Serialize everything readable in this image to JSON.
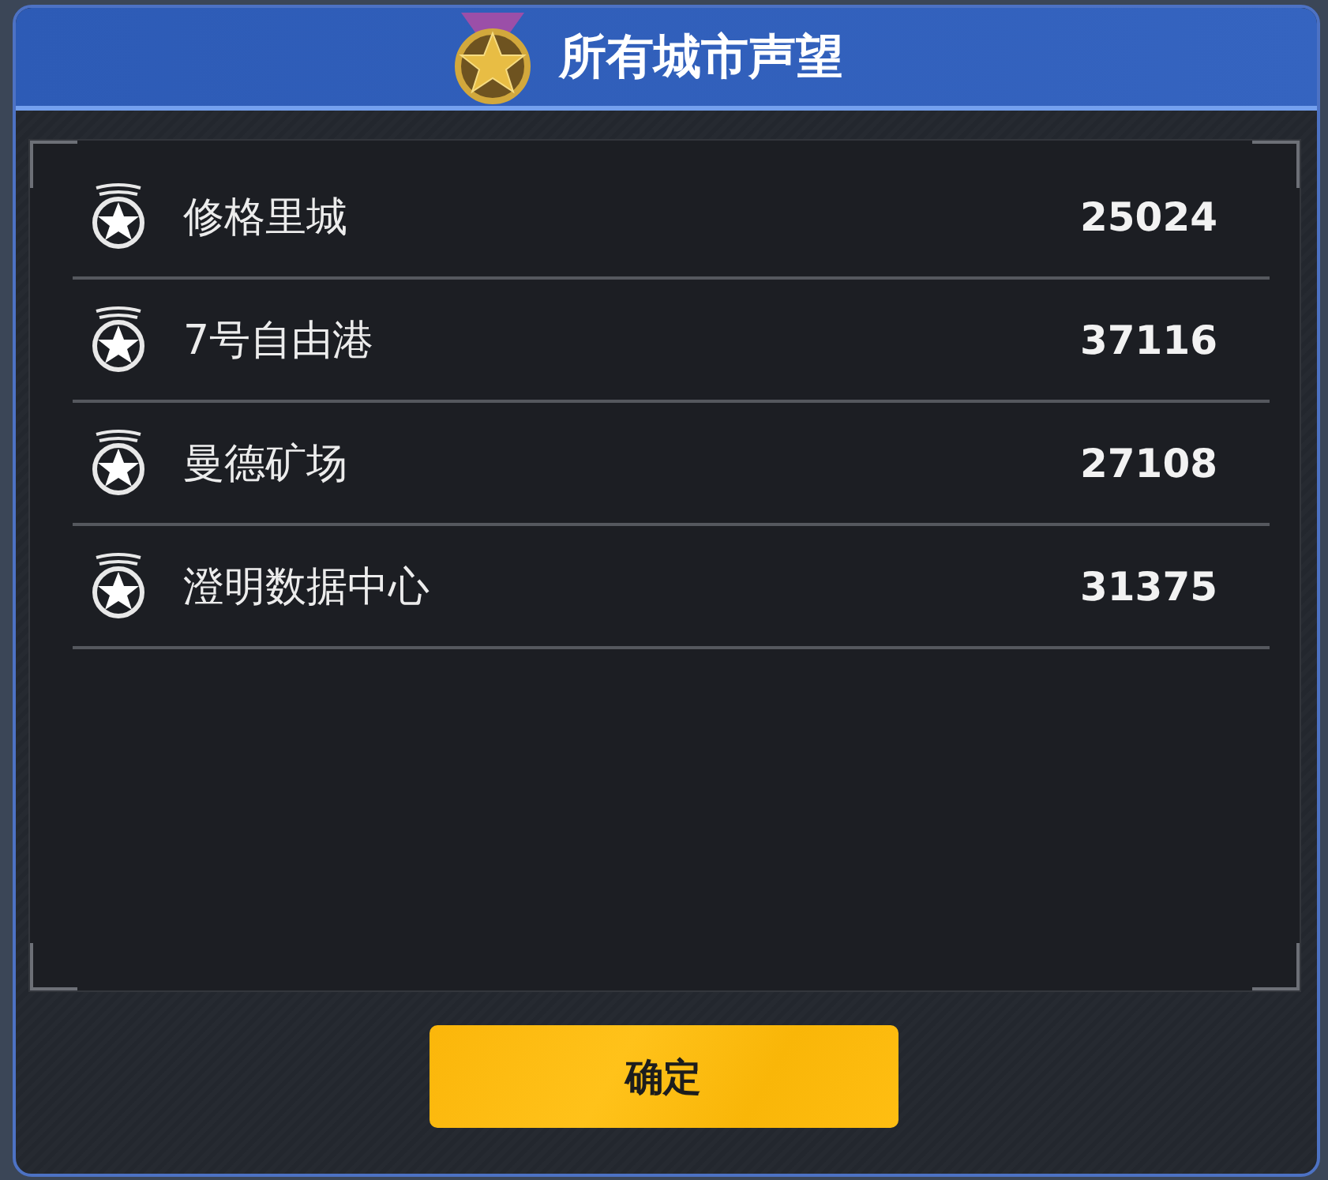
{
  "dialog": {
    "title": "所有城市声望"
  },
  "cities": [
    {
      "name": "修格里城",
      "reputation": "25024"
    },
    {
      "name": "7号自由港",
      "reputation": "37116"
    },
    {
      "name": "曼德矿场",
      "reputation": "27108"
    },
    {
      "name": "澄明数据中心",
      "reputation": "31375"
    }
  ],
  "buttons": [
    "确定"
  ]
}
